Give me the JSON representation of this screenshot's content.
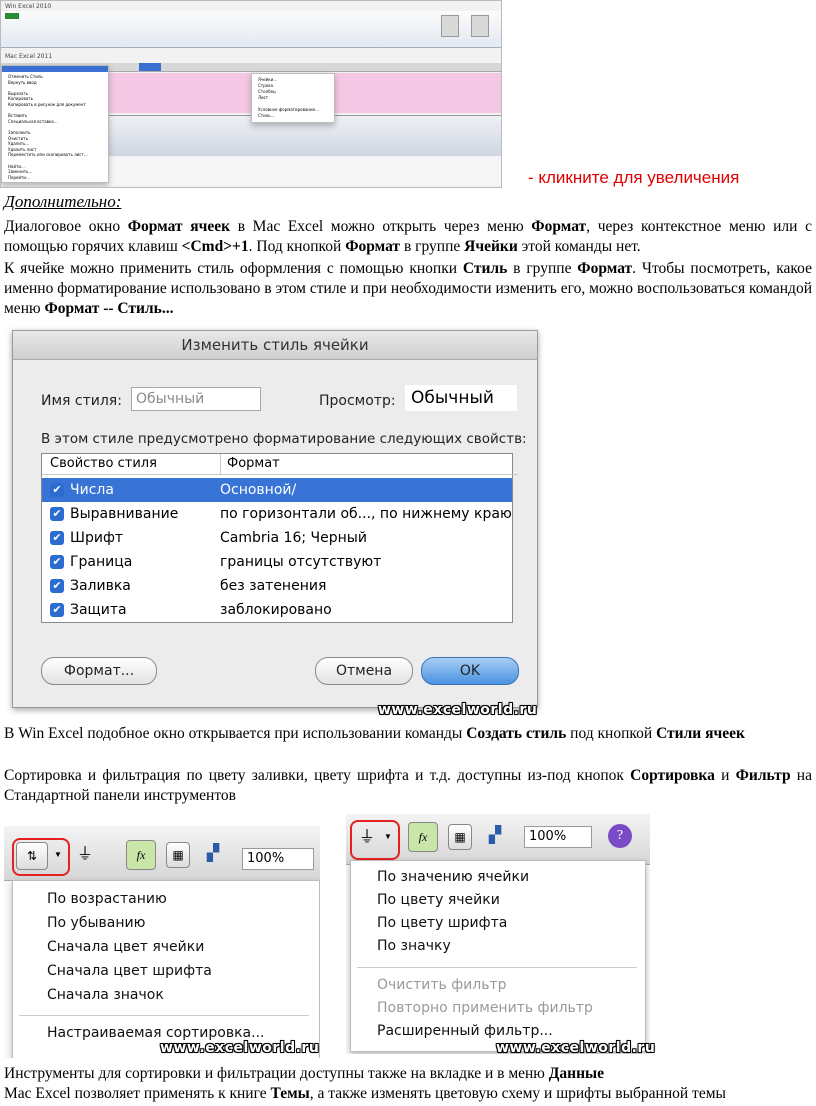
{
  "thumb": {
    "title": "Win Excel 2010",
    "mac_title": "Mac Excel 2011",
    "left_menu": [
      "Отменить Стиль",
      "Вернуть ввод",
      "",
      "Вырезать",
      "Копировать",
      "Копировать в рисунок для документ",
      "",
      "Вставить",
      "Специальная вставка...",
      "",
      "Заполнить",
      "Очистить",
      "Удалить...",
      "Удалить лист",
      "Переместить или скопировать лист...",
      "",
      "Найти...",
      "Заменить...",
      "Перейти..."
    ],
    "format_menu": [
      "Ячейки...",
      "Строка",
      "Столбец",
      "Лист",
      "",
      "Условное форматирование...",
      "Стиль..."
    ]
  },
  "link_text": "- кликните для увеличения",
  "heading": "Дополнительно:",
  "para1": {
    "t1": "Диалоговое окно ",
    "b1": "Формат ячеек",
    "t2": " в Mac Excel можно открыть через меню ",
    "b2": "Формат",
    "t3": ", через контекстное меню или с помощью горячих клавиш ",
    "b3": "<Cmd>+1",
    "t4": ". Под кнопкой ",
    "b4": "Формат",
    "t5": " в группе ",
    "b5": "Ячейки",
    "t6": " этой команды нет."
  },
  "para2": {
    "t1": "К ячейке можно применить стиль оформления с помощью кнопки ",
    "b1": "Стиль",
    "t2": " в группе ",
    "b2": "Формат",
    "t3": ". Чтобы посмотреть, какое именно форматирование использовано в этом стиле и при необходимости изменить его, можно воспользоваться командой меню ",
    "b3": "Формат -- Стиль..."
  },
  "dialog": {
    "title": "Изменить стиль ячейки",
    "style_name_label": "Имя стиля:",
    "style_name_value": "Обычный",
    "preview_label": "Просмотр:",
    "preview_value": "Обычный",
    "group_label": "В этом стиле предусмотрено форматирование следующих свойств:",
    "col_property": "Свойство стиля",
    "col_format": "Формат",
    "rows": [
      {
        "prop": "Числа",
        "fmt": "Основной/",
        "selected": true
      },
      {
        "prop": "Выравнивание",
        "fmt": "по горизонтали об..., по нижнему краю",
        "selected": false
      },
      {
        "prop": "Шрифт",
        "fmt": "Cambria 16; Черный",
        "selected": false
      },
      {
        "prop": "Граница",
        "fmt": "границы отсутствуют",
        "selected": false
      },
      {
        "prop": "Заливка",
        "fmt": "без затенения",
        "selected": false
      },
      {
        "prop": "Защита",
        "fmt": "заблокировано",
        "selected": false
      }
    ],
    "format_button": "Формат...",
    "cancel_button": "Отмена",
    "ok_button": "OK",
    "watermark": "www.excelworld.ru"
  },
  "para3": {
    "t1": "В Win Excel подобное окно открывается при использовании команды ",
    "b1": "Создать стиль",
    "t2": " под кнопкой ",
    "b2": "Стили ячеек"
  },
  "para4": {
    "t1": "Сортировка и фильтрация по цвету заливки, цвету шрифта и т.д. доступны из-под кнопок ",
    "b1": "Сортировка",
    "t2": " и ",
    "b2": "Фильтр",
    "t3": " на Стандартной панели инструментов"
  },
  "sort_panel": {
    "zoom": "100%",
    "items": [
      "По возрастанию",
      "По убыванию",
      "Сначала цвет ячейки",
      "Сначала цвет шрифта",
      "Сначала значок",
      "Настраиваемая сортировка..."
    ],
    "watermark": "www.excelworld.ru"
  },
  "filter_panel": {
    "zoom": "100%",
    "items": [
      "По значению ячейки",
      "По цвету ячейки",
      "По цвету шрифта",
      "По значку"
    ],
    "disabled_items": [
      "Очистить фильтр",
      "Повторно применить фильтр"
    ],
    "last_item": "Расширенный фильтр...",
    "watermark": "www.excelworld.ru"
  },
  "para5": {
    "t1": "Инструменты для сортировки и фильтрации доступны также на вкладке и в меню ",
    "b1": "Данные"
  },
  "para6": {
    "t1": "Mac Excel позволяет применять к книге ",
    "b1": "Темы",
    "t2": ", а также изменять цветовую схему и шрифты выбранной темы"
  }
}
